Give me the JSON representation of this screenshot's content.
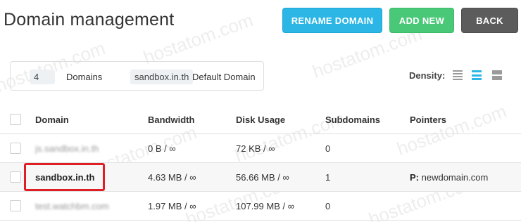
{
  "header": {
    "title": "Domain management",
    "buttons": {
      "rename": "RENAME DOMAIN",
      "add_new": "ADD NEW",
      "back": "BACK"
    }
  },
  "summary": {
    "count": "4",
    "count_label": "Domains",
    "default_domain": "sandbox.in.th",
    "default_label": "Default Domain"
  },
  "density": {
    "label": "Density:",
    "selected": "medium"
  },
  "table": {
    "columns": [
      "Domain",
      "Bandwidth",
      "Disk Usage",
      "Subdomains",
      "Pointers"
    ],
    "rows": [
      {
        "domain": "js.sandbox.in.th",
        "bandwidth": "0 B / ∞",
        "disk": "72 KB / ∞",
        "subdomains": "0",
        "pointers_label": "",
        "pointers": ""
      },
      {
        "domain": "sandbox.in.th",
        "bandwidth": "4.63 MB / ∞",
        "disk": "56.66 MB / ∞",
        "subdomains": "1",
        "pointers_label": "P:",
        "pointers": "newdomain.com"
      },
      {
        "domain": "test.watchbm.com",
        "bandwidth": "1.97 MB / ∞",
        "disk": "107.99 MB / ∞",
        "subdomains": "0",
        "pointers_label": "",
        "pointers": ""
      }
    ]
  },
  "watermark": "hostatom.com",
  "colors": {
    "rename": "#2bb6e6",
    "add": "#49c877",
    "back": "#5c5c5c",
    "highlight": "#e01e26"
  }
}
